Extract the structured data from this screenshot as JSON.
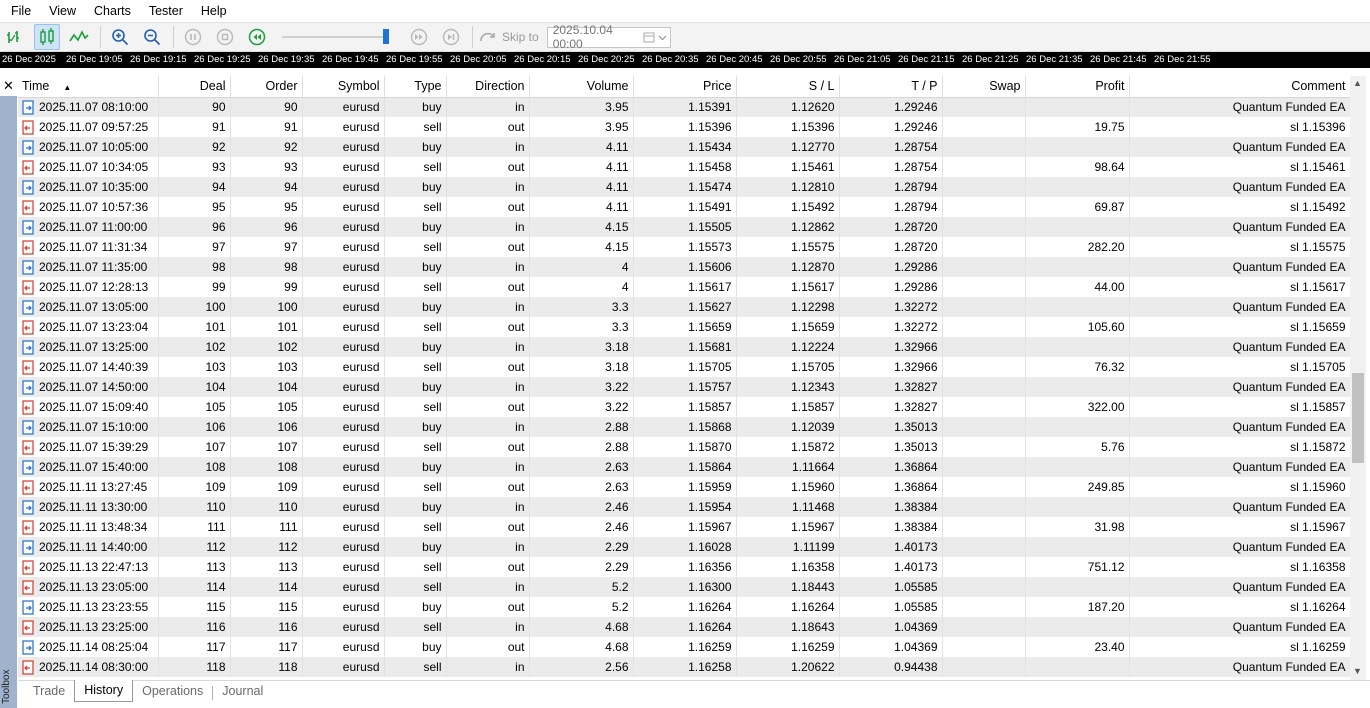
{
  "menu": [
    "File",
    "View",
    "Charts",
    "Tester",
    "Help"
  ],
  "toolbar": {
    "skip_to_label": "Skip to",
    "date_value": "2025.10.04 00:00",
    "speed_slider_level": 0.95
  },
  "timescale": [
    "26 Dec 2025",
    "26 Dec 19:05",
    "26 Dec 19:15",
    "26 Dec 19:25",
    "26 Dec 19:35",
    "26 Dec 19:45",
    "26 Dec 19:55",
    "26 Dec 20:05",
    "26 Dec 20:15",
    "26 Dec 20:25",
    "26 Dec 20:35",
    "26 Dec 20:45",
    "26 Dec 20:55",
    "26 Dec 21:05",
    "26 Dec 21:15",
    "26 Dec 21:25",
    "26 Dec 21:35",
    "26 Dec 21:45",
    "26 Dec 21:55"
  ],
  "columns": [
    "Time",
    "Deal",
    "Order",
    "Symbol",
    "Type",
    "Direction",
    "Volume",
    "Price",
    "S / L",
    "T / P",
    "Swap",
    "Profit",
    "Comment"
  ],
  "sort_indicator": "▲",
  "rows": [
    [
      "2025.11.07 08:10:00",
      "90",
      "90",
      "eurusd",
      "buy",
      "in",
      "3.95",
      "1.15391",
      "1.12620",
      "1.29246",
      "",
      "",
      "Quantum Funded EA"
    ],
    [
      "2025.11.07 09:57:25",
      "91",
      "91",
      "eurusd",
      "sell",
      "out",
      "3.95",
      "1.15396",
      "1.15396",
      "1.29246",
      "",
      "19.75",
      "sl 1.15396"
    ],
    [
      "2025.11.07 10:05:00",
      "92",
      "92",
      "eurusd",
      "buy",
      "in",
      "4.11",
      "1.15434",
      "1.12770",
      "1.28754",
      "",
      "",
      "Quantum Funded EA"
    ],
    [
      "2025.11.07 10:34:05",
      "93",
      "93",
      "eurusd",
      "sell",
      "out",
      "4.11",
      "1.15458",
      "1.15461",
      "1.28754",
      "",
      "98.64",
      "sl 1.15461"
    ],
    [
      "2025.11.07 10:35:00",
      "94",
      "94",
      "eurusd",
      "buy",
      "in",
      "4.11",
      "1.15474",
      "1.12810",
      "1.28794",
      "",
      "",
      "Quantum Funded EA"
    ],
    [
      "2025.11.07 10:57:36",
      "95",
      "95",
      "eurusd",
      "sell",
      "out",
      "4.11",
      "1.15491",
      "1.15492",
      "1.28794",
      "",
      "69.87",
      "sl 1.15492"
    ],
    [
      "2025.11.07 11:00:00",
      "96",
      "96",
      "eurusd",
      "buy",
      "in",
      "4.15",
      "1.15505",
      "1.12862",
      "1.28720",
      "",
      "",
      "Quantum Funded EA"
    ],
    [
      "2025.11.07 11:31:34",
      "97",
      "97",
      "eurusd",
      "sell",
      "out",
      "4.15",
      "1.15573",
      "1.15575",
      "1.28720",
      "",
      "282.20",
      "sl 1.15575"
    ],
    [
      "2025.11.07 11:35:00",
      "98",
      "98",
      "eurusd",
      "buy",
      "in",
      "4",
      "1.15606",
      "1.12870",
      "1.29286",
      "",
      "",
      "Quantum Funded EA"
    ],
    [
      "2025.11.07 12:28:13",
      "99",
      "99",
      "eurusd",
      "sell",
      "out",
      "4",
      "1.15617",
      "1.15617",
      "1.29286",
      "",
      "44.00",
      "sl 1.15617"
    ],
    [
      "2025.11.07 13:05:00",
      "100",
      "100",
      "eurusd",
      "buy",
      "in",
      "3.3",
      "1.15627",
      "1.12298",
      "1.32272",
      "",
      "",
      "Quantum Funded EA"
    ],
    [
      "2025.11.07 13:23:04",
      "101",
      "101",
      "eurusd",
      "sell",
      "out",
      "3.3",
      "1.15659",
      "1.15659",
      "1.32272",
      "",
      "105.60",
      "sl 1.15659"
    ],
    [
      "2025.11.07 13:25:00",
      "102",
      "102",
      "eurusd",
      "buy",
      "in",
      "3.18",
      "1.15681",
      "1.12224",
      "1.32966",
      "",
      "",
      "Quantum Funded EA"
    ],
    [
      "2025.11.07 14:40:39",
      "103",
      "103",
      "eurusd",
      "sell",
      "out",
      "3.18",
      "1.15705",
      "1.15705",
      "1.32966",
      "",
      "76.32",
      "sl 1.15705"
    ],
    [
      "2025.11.07 14:50:00",
      "104",
      "104",
      "eurusd",
      "buy",
      "in",
      "3.22",
      "1.15757",
      "1.12343",
      "1.32827",
      "",
      "",
      "Quantum Funded EA"
    ],
    [
      "2025.11.07 15:09:40",
      "105",
      "105",
      "eurusd",
      "sell",
      "out",
      "3.22",
      "1.15857",
      "1.15857",
      "1.32827",
      "",
      "322.00",
      "sl 1.15857"
    ],
    [
      "2025.11.07 15:10:00",
      "106",
      "106",
      "eurusd",
      "buy",
      "in",
      "2.88",
      "1.15868",
      "1.12039",
      "1.35013",
      "",
      "",
      "Quantum Funded EA"
    ],
    [
      "2025.11.07 15:39:29",
      "107",
      "107",
      "eurusd",
      "sell",
      "out",
      "2.88",
      "1.15870",
      "1.15872",
      "1.35013",
      "",
      "5.76",
      "sl 1.15872"
    ],
    [
      "2025.11.07 15:40:00",
      "108",
      "108",
      "eurusd",
      "buy",
      "in",
      "2.63",
      "1.15864",
      "1.11664",
      "1.36864",
      "",
      "",
      "Quantum Funded EA"
    ],
    [
      "2025.11.11 13:27:45",
      "109",
      "109",
      "eurusd",
      "sell",
      "out",
      "2.63",
      "1.15959",
      "1.15960",
      "1.36864",
      "",
      "249.85",
      "sl 1.15960"
    ],
    [
      "2025.11.11 13:30:00",
      "110",
      "110",
      "eurusd",
      "buy",
      "in",
      "2.46",
      "1.15954",
      "1.11468",
      "1.38384",
      "",
      "",
      "Quantum Funded EA"
    ],
    [
      "2025.11.11 13:48:34",
      "111",
      "111",
      "eurusd",
      "sell",
      "out",
      "2.46",
      "1.15967",
      "1.15967",
      "1.38384",
      "",
      "31.98",
      "sl 1.15967"
    ],
    [
      "2025.11.11 14:40:00",
      "112",
      "112",
      "eurusd",
      "buy",
      "in",
      "2.29",
      "1.16028",
      "1.11199",
      "1.40173",
      "",
      "",
      "Quantum Funded EA"
    ],
    [
      "2025.11.13 22:47:13",
      "113",
      "113",
      "eurusd",
      "sell",
      "out",
      "2.29",
      "1.16356",
      "1.16358",
      "1.40173",
      "",
      "751.12",
      "sl 1.16358"
    ],
    [
      "2025.11.13 23:05:00",
      "114",
      "114",
      "eurusd",
      "sell",
      "in",
      "5.2",
      "1.16300",
      "1.18443",
      "1.05585",
      "",
      "",
      "Quantum Funded EA"
    ],
    [
      "2025.11.13 23:23:55",
      "115",
      "115",
      "eurusd",
      "buy",
      "out",
      "5.2",
      "1.16264",
      "1.16264",
      "1.05585",
      "",
      "187.20",
      "sl 1.16264"
    ],
    [
      "2025.11.13 23:25:00",
      "116",
      "116",
      "eurusd",
      "sell",
      "in",
      "4.68",
      "1.16264",
      "1.18643",
      "1.04369",
      "",
      "",
      "Quantum Funded EA"
    ],
    [
      "2025.11.14 08:25:04",
      "117",
      "117",
      "eurusd",
      "buy",
      "out",
      "4.68",
      "1.16259",
      "1.16259",
      "1.04369",
      "",
      "23.40",
      "sl 1.16259"
    ],
    [
      "2025.11.14 08:30:00",
      "118",
      "118",
      "eurusd",
      "sell",
      "in",
      "2.56",
      "1.16258",
      "1.20622",
      "0.94438",
      "",
      "",
      "Quantum Funded EA"
    ]
  ],
  "icon_colors": {
    "buy": "#1f6fc8",
    "sell": "#d23a2a"
  },
  "tabs": [
    {
      "label": "Trade",
      "active": false
    },
    {
      "label": "History",
      "active": true
    },
    {
      "label": "Operations",
      "active": false
    },
    {
      "label": "Journal",
      "active": false
    }
  ],
  "toolbox_label": "Toolbox"
}
